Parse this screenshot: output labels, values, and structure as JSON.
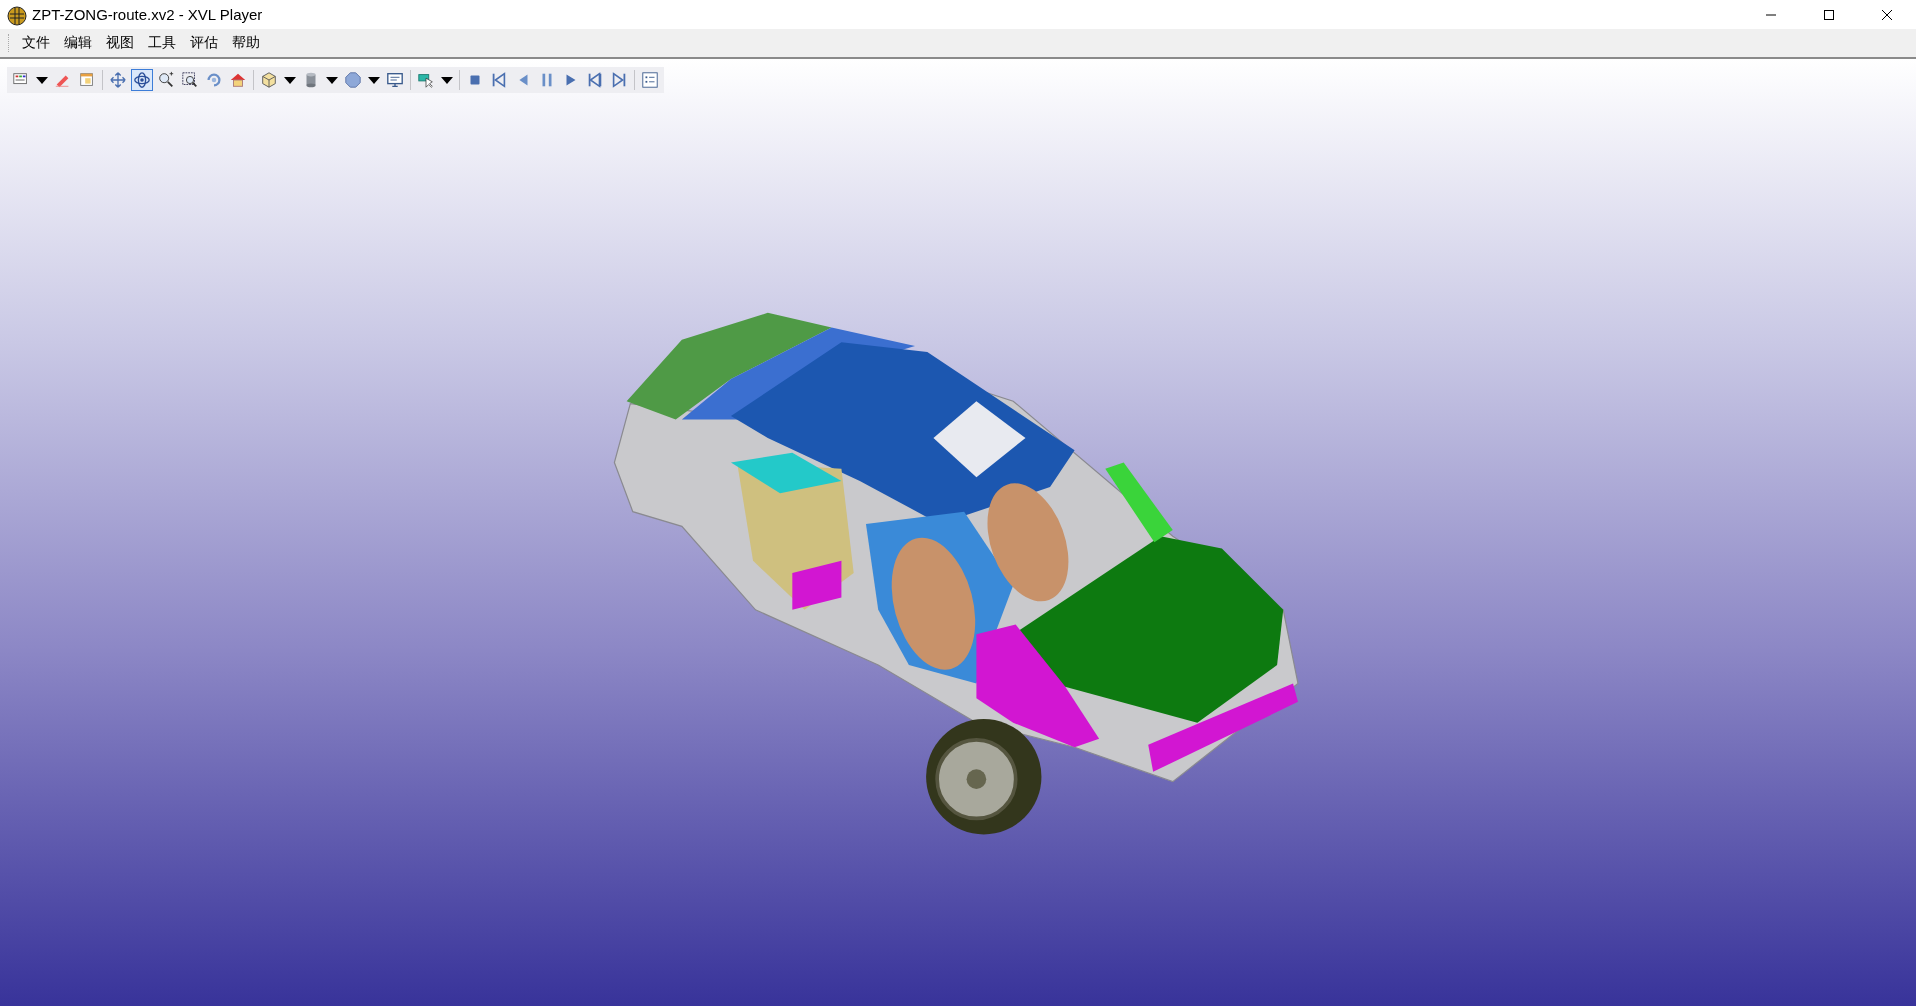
{
  "window": {
    "title": "ZPT-ZONG-route.xv2 - XVL Player"
  },
  "menu": [
    "文件",
    "编辑",
    "视图",
    "工具",
    "评估",
    "帮助"
  ],
  "toolbar": [
    [
      {
        "kind": "tool",
        "selected": false
      },
      {
        "kind": "dropdown",
        "selected": false
      },
      {
        "kind": "tool",
        "selected": false
      },
      {
        "kind": "tool",
        "selected": false
      }
    ],
    [
      {
        "kind": "tool",
        "selected": false
      },
      {
        "kind": "tool",
        "selected": true
      },
      {
        "kind": "tool",
        "selected": false
      },
      {
        "kind": "tool",
        "selected": false
      },
      {
        "kind": "tool",
        "selected": false
      },
      {
        "kind": "tool",
        "selected": false
      }
    ],
    [
      {
        "kind": "tool",
        "selected": false
      },
      {
        "kind": "dropdown",
        "selected": false
      },
      {
        "kind": "tool",
        "selected": false
      },
      {
        "kind": "dropdown",
        "selected": false
      },
      {
        "kind": "tool",
        "selected": false
      },
      {
        "kind": "dropdown",
        "selected": false
      },
      {
        "kind": "tool",
        "selected": false
      }
    ],
    [
      {
        "kind": "tool",
        "selected": false
      },
      {
        "kind": "dropdown",
        "selected": false
      }
    ],
    [
      {
        "kind": "tool",
        "selected": false
      },
      {
        "kind": "tool",
        "selected": false
      },
      {
        "kind": "tool",
        "selected": false
      },
      {
        "kind": "tool",
        "selected": false
      },
      {
        "kind": "tool",
        "selected": false
      },
      {
        "kind": "tool",
        "selected": false
      },
      {
        "kind": "tool",
        "selected": false
      }
    ],
    [
      {
        "kind": "tool",
        "selected": false
      }
    ]
  ]
}
